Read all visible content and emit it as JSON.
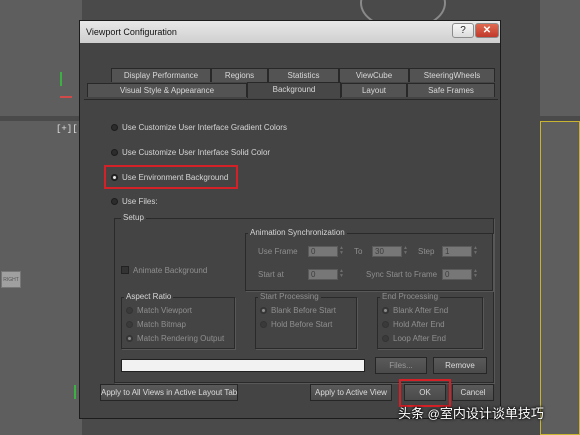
{
  "viewport": {
    "label": "[+]["
  },
  "dialog": {
    "title": "Viewport Configuration",
    "help_label": "?",
    "close_label": "✕",
    "tabs_row1": [
      "Display Performance",
      "Regions",
      "Statistics",
      "ViewCube",
      "SteeringWheels"
    ],
    "tabs_row2": [
      "Visual Style & Appearance",
      "Background",
      "Layout",
      "Safe Frames"
    ],
    "active_tab": "Background"
  },
  "background_options": [
    {
      "label": "Use Customize User Interface Gradient Colors",
      "selected": false
    },
    {
      "label": "Use Customize User Interface Solid Color",
      "selected": false
    },
    {
      "label": "Use Environment Background",
      "selected": true,
      "highlighted": true
    },
    {
      "label": "Use Files:",
      "selected": false
    }
  ],
  "setup": {
    "title": "Setup",
    "animate_background": {
      "label": "Animate Background",
      "checked": false
    },
    "animation_sync": {
      "title": "Animation Synchronization",
      "use_frame_label": "Use Frame",
      "use_frame_value": "0",
      "to_label": "To",
      "to_value": "30",
      "step_label": "Step",
      "step_value": "1",
      "start_at_label": "Start at",
      "start_at_value": "0",
      "sync_label": "Sync Start to Frame",
      "sync_value": "0"
    },
    "aspect_ratio": {
      "title": "Aspect Ratio",
      "options": [
        "Match Viewport",
        "Match Bitmap",
        "Match Rendering Output"
      ],
      "selected": "Match Rendering Output"
    },
    "start_processing": {
      "title": "Start Processing",
      "options": [
        "Blank Before Start",
        "Hold Before Start"
      ],
      "selected": "Blank Before Start"
    },
    "end_processing": {
      "title": "End Processing",
      "options": [
        "Blank After End",
        "Hold After End",
        "Loop After End"
      ],
      "selected": "Blank After End"
    },
    "file_path": "",
    "files_button": "Files...",
    "remove_button": "Remove"
  },
  "footer": {
    "apply_all": "Apply to All Views in Active Layout Tab",
    "apply_active": "Apply to Active View",
    "ok": "OK",
    "cancel": "Cancel"
  },
  "watermark": {
    "prefix": "头条",
    "at": "@",
    "name": "室内设计谈单技巧"
  },
  "colors": {
    "highlight": "#d42027",
    "dialog_bg": "#444444",
    "viewport_border": "#c9b431"
  }
}
